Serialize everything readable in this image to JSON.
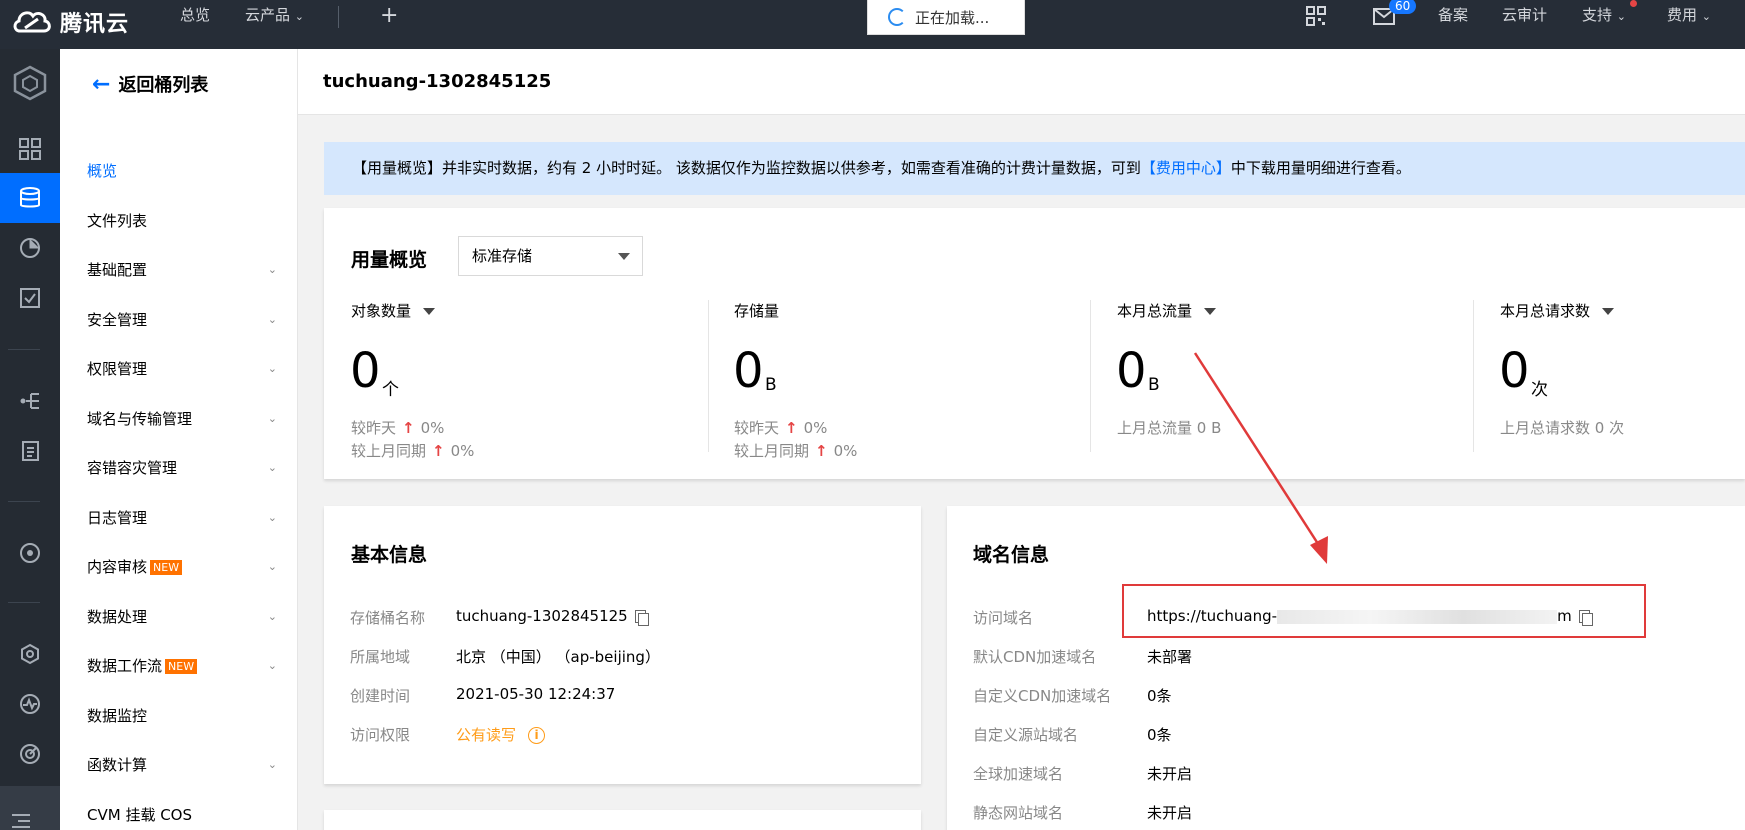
{
  "topbar": {
    "brand": "腾讯云",
    "nav": {
      "overview": "总览",
      "products": "云产品"
    },
    "loading": "正在加载...",
    "badge_count": "60",
    "right": {
      "beian": "备案",
      "audit": "云审计",
      "support": "支持",
      "billing": "费用"
    }
  },
  "sidebar": {
    "back": "返回桶列表",
    "items": [
      {
        "label": "概览",
        "active": true,
        "chevron": false
      },
      {
        "label": "文件列表",
        "chevron": false
      },
      {
        "label": "基础配置",
        "chevron": true
      },
      {
        "label": "安全管理",
        "chevron": true
      },
      {
        "label": "权限管理",
        "chevron": true
      },
      {
        "label": "域名与传输管理",
        "chevron": true
      },
      {
        "label": "容错容灾管理",
        "chevron": true
      },
      {
        "label": "日志管理",
        "chevron": true
      },
      {
        "label": "内容审核",
        "chevron": true,
        "tag": "NEW"
      },
      {
        "label": "数据处理",
        "chevron": true
      },
      {
        "label": "数据工作流",
        "chevron": true,
        "tag": "NEW"
      },
      {
        "label": "数据监控",
        "chevron": false
      },
      {
        "label": "函数计算",
        "chevron": true
      },
      {
        "label": "CVM 挂载 COS",
        "chevron": false
      }
    ]
  },
  "header": {
    "title": "tuchuang-1302845125"
  },
  "notice": {
    "prefix": "【用量概览】并非实时数据，约有 2 小时时延。 该数据仅作为监控数据以供参考，如需查看准确的计费计量数据，可到",
    "link": "【费用中心】",
    "suffix": "中下载用量明细进行查看。"
  },
  "usage": {
    "title": "用量概览",
    "select_value": "标准存储",
    "metrics": [
      {
        "label": "对象数量",
        "value": "0",
        "unit": "个",
        "sub1_label": "较昨天",
        "sub1_value": "0%",
        "sub2_label": "较上月同期",
        "sub2_value": "0%"
      },
      {
        "label": "存储量",
        "value": "0",
        "unit": "B",
        "sub1_label": "较昨天",
        "sub1_value": "0%",
        "sub2_label": "较上月同期",
        "sub2_value": "0%"
      },
      {
        "label": "本月总流量",
        "value": "0",
        "unit": "B",
        "sub": "上月总流量 0 B"
      },
      {
        "label": "本月总请求数",
        "value": "0",
        "unit": "次",
        "sub": "上月总请求数 0 次"
      }
    ]
  },
  "basic": {
    "title": "基本信息",
    "rows": [
      {
        "label": "存储桶名称",
        "value": "tuchuang-1302845125"
      },
      {
        "label": "所属地域",
        "value": "北京 （中国） （ap-beijing）"
      },
      {
        "label": "创建时间",
        "value": "2021-05-30 12:24:37"
      },
      {
        "label": "访问权限",
        "value": "公有读写"
      }
    ]
  },
  "domain": {
    "title": "域名信息",
    "rows": [
      {
        "label": "访问域名",
        "value_prefix": "https://tuchuang-",
        "value_suffix": "m"
      },
      {
        "label": "默认CDN加速域名",
        "value": "未部署"
      },
      {
        "label": "自定义CDN加速域名",
        "value": "0条"
      },
      {
        "label": "自定义源站域名",
        "value": "0条"
      },
      {
        "label": "全球加速域名",
        "value": "未开启"
      },
      {
        "label": "静态网站域名",
        "value": "未开启"
      }
    ]
  },
  "colors": {
    "accent": "#006eff",
    "topbar": "#262d37",
    "rail": "#252b33",
    "annotation": "#e03a3a",
    "warning": "#ff9c19"
  }
}
